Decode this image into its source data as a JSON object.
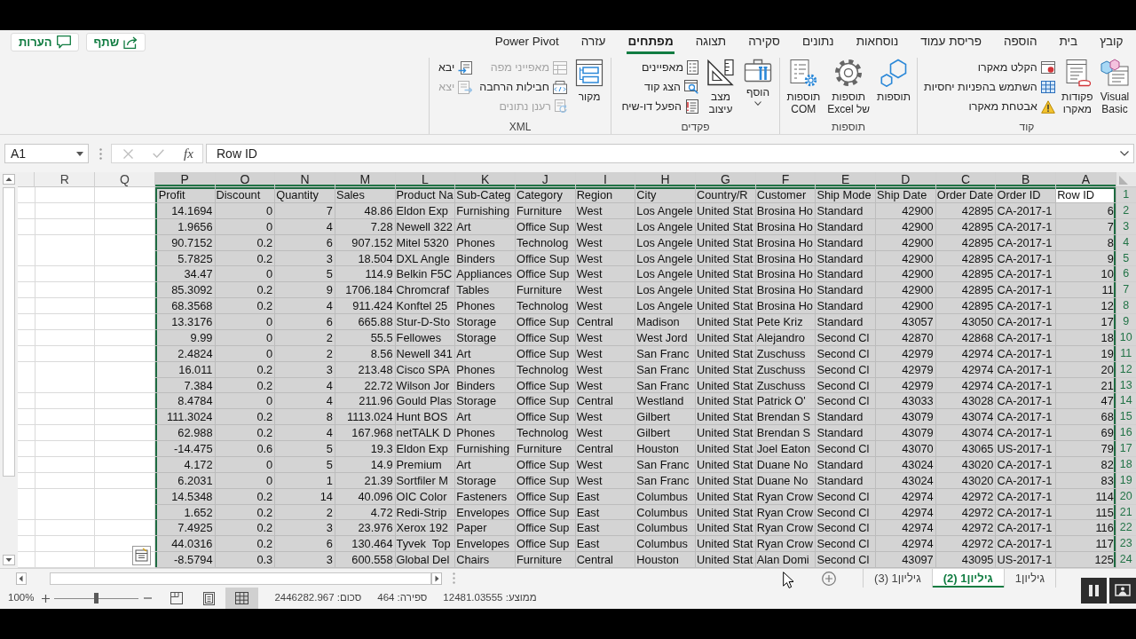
{
  "tabs": [
    {
      "label": "קובץ",
      "selected": false
    },
    {
      "label": "בית",
      "selected": false
    },
    {
      "label": "הוספה",
      "selected": false
    },
    {
      "label": "פריסת עמוד",
      "selected": false
    },
    {
      "label": "נוסחאות",
      "selected": false
    },
    {
      "label": "נתונים",
      "selected": false
    },
    {
      "label": "סקירה",
      "selected": false
    },
    {
      "label": "תצוגה",
      "selected": false
    },
    {
      "label": "מפתחים",
      "selected": true
    },
    {
      "label": "עזרה",
      "selected": false
    },
    {
      "label": "Power Pivot",
      "selected": false
    }
  ],
  "header_buttons": [
    {
      "kind": "share",
      "label": "שתף"
    },
    {
      "kind": "comments",
      "label": "הערות"
    }
  ],
  "ribbon_groups": [
    {
      "label": "קוד",
      "items": [
        {
          "kind": "large",
          "label": "Visual\nBasic",
          "dropdown": false
        },
        {
          "kind": "large",
          "label": "פקודות\nמאקרו",
          "dropdown": false
        },
        {
          "kind": "small",
          "label": "הקלט מאקרו",
          "disabled": false
        },
        {
          "kind": "small",
          "label": "השתמש בהפניות יחסיות",
          "disabled": false
        },
        {
          "kind": "small",
          "label": "אבטחת מאקרו",
          "disabled": false
        }
      ]
    },
    {
      "label": "תוספות",
      "items": [
        {
          "kind": "large",
          "label": "תוספות",
          "dropdown": false
        },
        {
          "kind": "large",
          "label": "תוספות\nשל Excel",
          "dropdown": false
        },
        {
          "kind": "large",
          "label": "תוספות\nCOM",
          "dropdown": false
        }
      ]
    },
    {
      "label": "פקדים",
      "items": [
        {
          "kind": "large",
          "label": "הוסף",
          "dropdown": true
        },
        {
          "kind": "large",
          "label": "מצב\nעיצוב",
          "dropdown": false
        },
        {
          "kind": "small",
          "label": "מאפיינים",
          "disabled": false
        },
        {
          "kind": "small",
          "label": "הצג קוד",
          "disabled": false
        },
        {
          "kind": "small",
          "label": "הפעל דו-שיח",
          "disabled": false
        }
      ]
    },
    {
      "label": "XML",
      "items": [
        {
          "kind": "large",
          "label": "מקור",
          "dropdown": false
        },
        {
          "kind": "small",
          "label": "מאפייני מפה",
          "disabled": true
        },
        {
          "kind": "small",
          "label": "חבילות הרחבה",
          "disabled": false
        },
        {
          "kind": "small",
          "label": "רענן נתונים",
          "disabled": true
        },
        {
          "kind": "small",
          "label": "יבא",
          "disabled": false
        },
        {
          "kind": "small",
          "label": "יצא",
          "disabled": true
        }
      ]
    }
  ],
  "formula_bar": {
    "name_box": "A1",
    "buttons": [
      {
        "kind": "cancel",
        "disabled": true
      },
      {
        "kind": "enter",
        "disabled": true
      },
      {
        "kind": "function",
        "label": "fx",
        "disabled": false
      }
    ],
    "value": "Row ID"
  },
  "sheet": {
    "blank_columns": [
      {
        "letter": "R",
        "selected": false
      },
      {
        "letter": "Q",
        "selected": false
      }
    ],
    "columns": [
      {
        "letter": "P",
        "kind": "number",
        "selected": true,
        "active": false
      },
      {
        "letter": "O",
        "kind": "number",
        "selected": true,
        "active": false
      },
      {
        "letter": "N",
        "kind": "number",
        "selected": true,
        "active": false
      },
      {
        "letter": "M",
        "kind": "number",
        "selected": true,
        "active": false
      },
      {
        "letter": "L",
        "kind": "text",
        "selected": true,
        "active": false
      },
      {
        "letter": "K",
        "kind": "text",
        "selected": true,
        "active": false
      },
      {
        "letter": "J",
        "kind": "text",
        "selected": true,
        "active": false
      },
      {
        "letter": "I",
        "kind": "text",
        "selected": true,
        "active": false
      },
      {
        "letter": "H",
        "kind": "text",
        "selected": true,
        "active": false
      },
      {
        "letter": "G",
        "kind": "text",
        "selected": true,
        "active": false
      },
      {
        "letter": "F",
        "kind": "text",
        "selected": true,
        "active": false
      },
      {
        "letter": "E",
        "kind": "text",
        "selected": true,
        "active": false
      },
      {
        "letter": "D",
        "kind": "number",
        "selected": true,
        "active": false
      },
      {
        "letter": "C",
        "kind": "number",
        "selected": true,
        "active": false
      },
      {
        "letter": "B",
        "kind": "text",
        "selected": true,
        "active": false
      },
      {
        "letter": "A",
        "kind": "number",
        "selected": true,
        "active": true
      }
    ],
    "rows": [
      {
        "number": "1",
        "kind": "header",
        "selected": true,
        "active": true,
        "cells": [
          "Profit",
          "Discount",
          "Quantity",
          "Sales",
          "Product Na",
          "Sub-Categ",
          "Category",
          "Region",
          "City",
          "Country/R",
          "Customer",
          "Ship Mode",
          "Ship Date",
          "Order Date",
          "Order ID",
          "Row ID"
        ]
      },
      {
        "number": "2",
        "kind": "data",
        "selected": true,
        "active": false,
        "cells": [
          "14.1694",
          "0",
          "7",
          "48.86",
          "Eldon Exp",
          "Furnishing",
          "Furniture",
          "West",
          "Los Angele",
          "United Stat",
          "Brosina Ho",
          "Standard",
          "42900",
          "42895",
          "CA-2017-1",
          "6"
        ]
      },
      {
        "number": "3",
        "kind": "data",
        "selected": true,
        "active": false,
        "cells": [
          "1.9656",
          "0",
          "4",
          "7.28",
          "Newell 322",
          "Art",
          "Office Sup",
          "West",
          "Los Angele",
          "United Stat",
          "Brosina Ho",
          "Standard",
          "42900",
          "42895",
          "CA-2017-1",
          "7"
        ]
      },
      {
        "number": "4",
        "kind": "data",
        "selected": true,
        "active": false,
        "cells": [
          "90.7152",
          "0.2",
          "6",
          "907.152",
          "Mitel 5320",
          "Phones",
          "Technolog",
          "West",
          "Los Angele",
          "United Stat",
          "Brosina Ho",
          "Standard",
          "42900",
          "42895",
          "CA-2017-1",
          "8"
        ]
      },
      {
        "number": "5",
        "kind": "data",
        "selected": true,
        "active": false,
        "cells": [
          "5.7825",
          "0.2",
          "3",
          "18.504",
          "DXL Angle",
          "Binders",
          "Office Sup",
          "West",
          "Los Angele",
          "United Stat",
          "Brosina Ho",
          "Standard",
          "42900",
          "42895",
          "CA-2017-1",
          "9"
        ]
      },
      {
        "number": "6",
        "kind": "data",
        "selected": true,
        "active": false,
        "cells": [
          "34.47",
          "0",
          "5",
          "114.9",
          "Belkin F5C",
          "Appliances",
          "Office Sup",
          "West",
          "Los Angele",
          "United Stat",
          "Brosina Ho",
          "Standard",
          "42900",
          "42895",
          "CA-2017-1",
          "10"
        ]
      },
      {
        "number": "7",
        "kind": "data",
        "selected": true,
        "active": false,
        "cells": [
          "85.3092",
          "0.2",
          "9",
          "1706.184",
          "Chromcraf",
          "Tables",
          "Furniture",
          "West",
          "Los Angele",
          "United Stat",
          "Brosina Ho",
          "Standard",
          "42900",
          "42895",
          "CA-2017-1",
          "11"
        ]
      },
      {
        "number": "8",
        "kind": "data",
        "selected": true,
        "active": false,
        "cells": [
          "68.3568",
          "0.2",
          "4",
          "911.424",
          "Konftel 25",
          "Phones",
          "Technolog",
          "West",
          "Los Angele",
          "United Stat",
          "Brosina Ho",
          "Standard",
          "42900",
          "42895",
          "CA-2017-1",
          "12"
        ]
      },
      {
        "number": "9",
        "kind": "data",
        "selected": true,
        "active": false,
        "cells": [
          "13.3176",
          "0",
          "6",
          "665.88",
          "Stur-D-Sto",
          "Storage",
          "Office Sup",
          "Central",
          "Madison",
          "United Stat",
          "Pete Kriz",
          "Standard",
          "43057",
          "43050",
          "CA-2017-1",
          "17"
        ]
      },
      {
        "number": "10",
        "kind": "data",
        "selected": true,
        "active": false,
        "cells": [
          "9.99",
          "0",
          "2",
          "55.5",
          "Fellowes",
          "Storage",
          "Office Sup",
          "West",
          "West Jord",
          "United Stat",
          "Alejandro",
          "Second Cl",
          "42870",
          "42868",
          "CA-2017-1",
          "18"
        ]
      },
      {
        "number": "11",
        "kind": "data",
        "selected": true,
        "active": false,
        "cells": [
          "2.4824",
          "0",
          "2",
          "8.56",
          "Newell 341",
          "Art",
          "Office Sup",
          "West",
          "San Franc",
          "United Stat",
          "Zuschuss",
          "Second Cl",
          "42979",
          "42974",
          "CA-2017-1",
          "19"
        ]
      },
      {
        "number": "12",
        "kind": "data",
        "selected": true,
        "active": false,
        "cells": [
          "16.011",
          "0.2",
          "3",
          "213.48",
          "Cisco SPA",
          "Phones",
          "Technolog",
          "West",
          "San Franc",
          "United Stat",
          "Zuschuss",
          "Second Cl",
          "42979",
          "42974",
          "CA-2017-1",
          "20"
        ]
      },
      {
        "number": "13",
        "kind": "data",
        "selected": true,
        "active": false,
        "cells": [
          "7.384",
          "0.2",
          "4",
          "22.72",
          "Wilson Jor",
          "Binders",
          "Office Sup",
          "West",
          "San Franc",
          "United Stat",
          "Zuschuss",
          "Second Cl",
          "42979",
          "42974",
          "CA-2017-1",
          "21"
        ]
      },
      {
        "number": "14",
        "kind": "data",
        "selected": true,
        "active": false,
        "cells": [
          "8.4784",
          "0",
          "4",
          "211.96",
          "Gould Plas",
          "Storage",
          "Office Sup",
          "Central",
          "Westland",
          "United Stat",
          "Patrick O'",
          "Second Cl",
          "43033",
          "43028",
          "CA-2017-1",
          "47"
        ]
      },
      {
        "number": "15",
        "kind": "data",
        "selected": true,
        "active": false,
        "cells": [
          "111.3024",
          "0.2",
          "8",
          "1113.024",
          "Hunt BOS",
          "Art",
          "Office Sup",
          "West",
          "Gilbert",
          "United Stat",
          "Brendan S",
          "Standard",
          "43079",
          "43074",
          "CA-2017-1",
          "68"
        ]
      },
      {
        "number": "16",
        "kind": "data",
        "selected": true,
        "active": false,
        "cells": [
          "62.988",
          "0.2",
          "4",
          "167.968",
          "netTALK D",
          "Phones",
          "Technolog",
          "West",
          "Gilbert",
          "United Stat",
          "Brendan S",
          "Standard",
          "43079",
          "43074",
          "CA-2017-1",
          "69"
        ]
      },
      {
        "number": "17",
        "kind": "data",
        "selected": true,
        "active": false,
        "cells": [
          "-14.475",
          "0.6",
          "5",
          "19.3",
          "Eldon Exp",
          "Furnishing",
          "Furniture",
          "Central",
          "Houston",
          "United Stat",
          "Joel Eaton",
          "Second Cl",
          "43070",
          "43065",
          "US-2017-1",
          "79"
        ]
      },
      {
        "number": "18",
        "kind": "data",
        "selected": true,
        "active": false,
        "cells": [
          "4.172",
          "0",
          "5",
          "14.9",
          "Premium",
          "Art",
          "Office Sup",
          "West",
          "San Franc",
          "United Stat",
          "Duane No",
          "Standard",
          "43024",
          "43020",
          "CA-2017-1",
          "82"
        ]
      },
      {
        "number": "19",
        "kind": "data",
        "selected": true,
        "active": false,
        "cells": [
          "6.2031",
          "0",
          "1",
          "21.39",
          "Sortfiler M",
          "Storage",
          "Office Sup",
          "West",
          "San Franc",
          "United Stat",
          "Duane No",
          "Standard",
          "43024",
          "43020",
          "CA-2017-1",
          "83"
        ]
      },
      {
        "number": "20",
        "kind": "data",
        "selected": true,
        "active": false,
        "cells": [
          "14.5348",
          "0.2",
          "14",
          "40.096",
          "OIC Color",
          "Fasteners",
          "Office Sup",
          "East",
          "Columbus",
          "United Stat",
          "Ryan Crow",
          "Second Cl",
          "42974",
          "42972",
          "CA-2017-1",
          "114"
        ]
      },
      {
        "number": "21",
        "kind": "data",
        "selected": true,
        "active": false,
        "cells": [
          "1.652",
          "0.2",
          "2",
          "4.72",
          "Redi-Strip",
          "Envelopes",
          "Office Sup",
          "East",
          "Columbus",
          "United Stat",
          "Ryan Crow",
          "Second Cl",
          "42974",
          "42972",
          "CA-2017-1",
          "115"
        ]
      },
      {
        "number": "22",
        "kind": "data",
        "selected": true,
        "active": false,
        "cells": [
          "7.4925",
          "0.2",
          "3",
          "23.976",
          "Xerox 192",
          "Paper",
          "Office Sup",
          "East",
          "Columbus",
          "United Stat",
          "Ryan Crow",
          "Second Cl",
          "42974",
          "42972",
          "CA-2017-1",
          "116"
        ]
      },
      {
        "number": "23",
        "kind": "data",
        "selected": true,
        "active": false,
        "cells": [
          "44.0316",
          "0.2",
          "6",
          "130.464",
          "Tyvek  Top",
          "Envelopes",
          "Office Sup",
          "East",
          "Columbus",
          "United Stat",
          "Ryan Crow",
          "Second Cl",
          "42974",
          "42972",
          "CA-2017-1",
          "117"
        ]
      },
      {
        "number": "24",
        "kind": "data",
        "selected": true,
        "active": false,
        "cells": [
          "-8.5794",
          "0.3",
          "3",
          "600.558",
          "Global Del",
          "Chairs",
          "Furniture",
          "Central",
          "Houston",
          "United Stat",
          "Alan Domi",
          "Second Cl",
          "43097",
          "43095",
          "US-2017-1",
          "125"
        ]
      }
    ]
  },
  "sheet_tabs": [
    {
      "label": "גיליון1",
      "selected": false
    },
    {
      "label": "גיליון1 (2)",
      "selected": true
    },
    {
      "label": "גיליון1 (3)",
      "selected": false
    }
  ],
  "status_bar": {
    "stats": [
      "ממוצע: 12481.03555",
      "ספירה: 464",
      "סכום: 2446282.967"
    ],
    "views": [
      {
        "kind": "normal",
        "selected": true
      },
      {
        "kind": "page_layout",
        "selected": false
      },
      {
        "kind": "page_break",
        "selected": false
      }
    ],
    "zoom": {
      "level": 0.5,
      "label": "100%"
    }
  }
}
